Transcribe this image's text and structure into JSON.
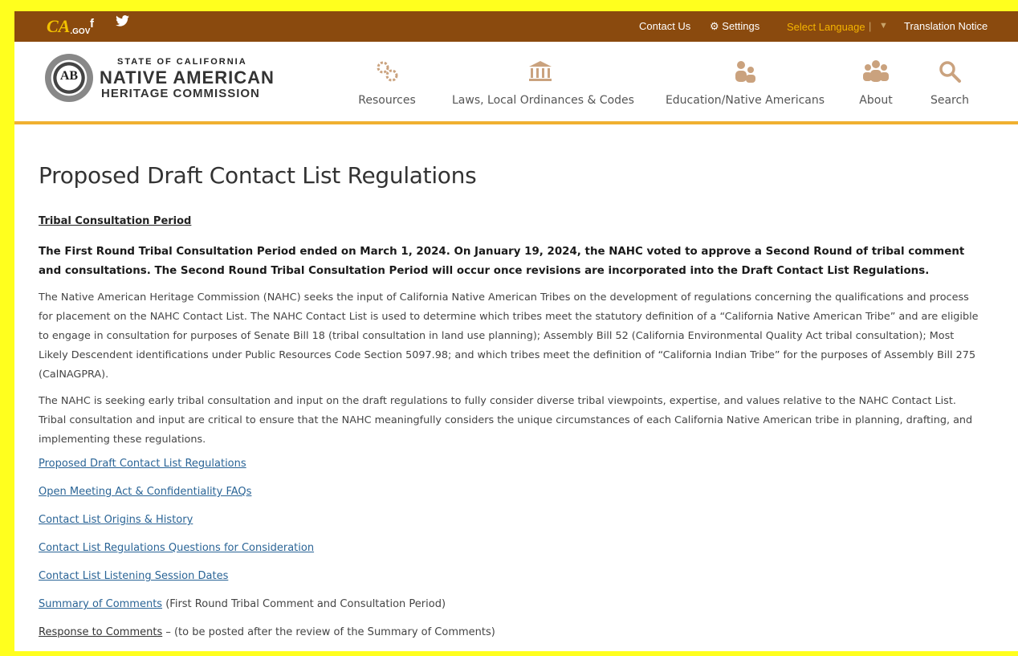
{
  "utility": {
    "logo": "CA",
    "logo_suffix": ".GOV",
    "facebook": "f",
    "twitter": "🐦",
    "contact": "Contact Us",
    "settings": "Settings",
    "language": "Select Language",
    "language_sep": "|",
    "language_arrow": "▼",
    "translation": "Translation Notice"
  },
  "header": {
    "seal": "AB",
    "line1": "STATE OF CALIFORNIA",
    "line2": "NATIVE AMERICAN",
    "line3": "HERITAGE COMMISSION",
    "nav": [
      {
        "label": "Resources",
        "icon": "gears-icon"
      },
      {
        "label": "Laws, Local Ordinances & Codes",
        "icon": "institution-icon"
      },
      {
        "label": "Education/Native Americans",
        "icon": "people-icon"
      },
      {
        "label": "About",
        "icon": "group-icon"
      },
      {
        "label": "Search",
        "icon": "search-icon"
      }
    ]
  },
  "main": {
    "title": "Proposed Draft Contact List Regulations",
    "section_heading": "Tribal Consultation Period",
    "bold_paragraph": "The First Round Tribal Consultation Period ended on March 1, 2024. On January 19, 2024, the NAHC voted to approve a Second Round of tribal comment and consultations. The Second Round Tribal Consultation Period will occur once revisions are incorporated into the Draft Contact List Regulations.",
    "paragraph1": "The Native American Heritage Commission (NAHC) seeks the input of California Native American Tribes on the development of regulations concerning the qualifications and process for placement on the NAHC Contact List. The NAHC Contact List is used to determine which tribes meet the statutory definition of a “California Native American Tribe” and are eligible to engage in consultation for purposes of Senate Bill 18 (tribal consultation in land use planning); Assembly Bill 52 (California Environmental Quality Act tribal consultation); Most Likely Descendent identifications under Public Resources Code Section 5097.98; and which tribes meet the definition of “California Indian Tribe” for the purposes of Assembly Bill 275 (CalNAGPRA).",
    "paragraph2": "The NAHC is seeking early tribal consultation and input on the draft regulations to fully consider diverse tribal viewpoints, expertise, and values relative to the NAHC Contact List. Tribal consultation and input are critical to ensure that the NAHC meaningfully considers the unique circumstances of each California Native American tribe in planning, drafting, and implementing these regulations.",
    "links": [
      "Proposed Draft Contact List Regulations",
      "Open Meeting Act & Confidentiality FAQs",
      "Contact List Origins & History",
      "Contact List Regulations Questions for Consideration",
      "Contact List Listening Session Dates"
    ],
    "summary_link": "Summary of Comments",
    "summary_note": " (First Round Tribal Comment and Consultation Period)",
    "response_link": "Response to Comments",
    "response_note": " – (to be posted after the review of the Summary of Comments)"
  },
  "colors": {
    "utility_bar": "#8a4a0e",
    "accent": "#f0b030",
    "link": "#2a6496",
    "highlight_border": "#ffff1e"
  }
}
